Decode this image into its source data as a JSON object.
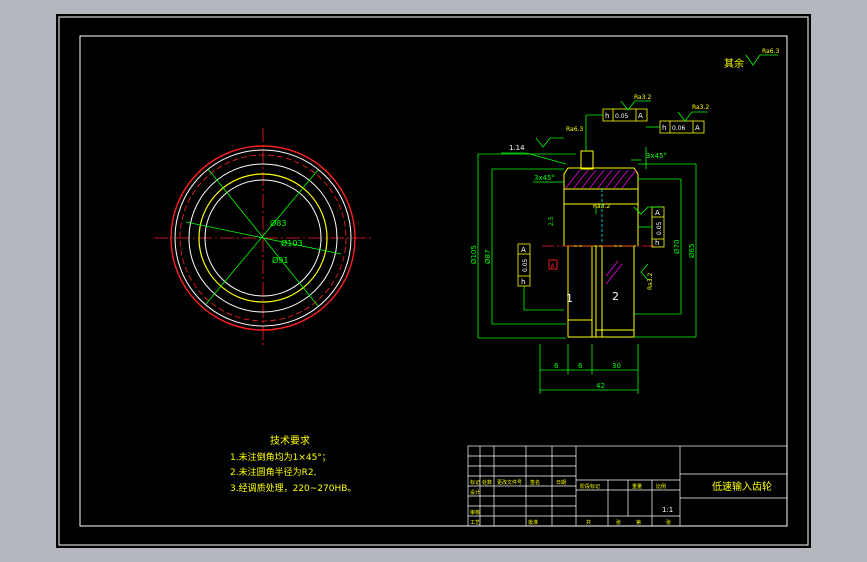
{
  "colors": {
    "background_window": "#b4b7bd",
    "paper": "#000000",
    "frame": "#ffffff",
    "outline": "#ffff00",
    "dimension": "#00ff00",
    "center": "#ff2020",
    "hatch": "#ff00ff",
    "hidden": "#00e5ff"
  },
  "front_view": {
    "dims": [
      "Ø83",
      "Ø103",
      "Ø91"
    ]
  },
  "section_view": {
    "roughness_other": "其余",
    "roughness_other_value": "Ra6.3",
    "roughness_1": "Ra3.2",
    "roughness_2": "Ra3.2",
    "roughness_3": "Ra6.3",
    "roughness_4": "Ra3.2",
    "roughness_5": "Ra3.2",
    "tol_1": [
      "h",
      "0.05",
      "A"
    ],
    "tol_2": [
      "h",
      "0.06",
      "A"
    ],
    "tol_3": [
      "h",
      "0.05",
      "A"
    ],
    "tol_4": [
      "h",
      "0.05",
      "A"
    ],
    "chamfer_top": "3x45°",
    "chamfer_left": "3x45°",
    "dim_114": "1.14",
    "dim_left_outer": "Ø105",
    "dim_left_inner": "Ø87",
    "dim_right_1": "Ø70",
    "dim_right_2": "Ø65",
    "dim_small": "2.5",
    "bottom_dims": [
      "6",
      "6",
      "30"
    ],
    "bottom_total": "42",
    "datum": "A",
    "part_labels": [
      "1",
      "2"
    ]
  },
  "tech_requirements": {
    "title": "技术要求",
    "lines": [
      "1.未注倒角均为1×45°；",
      "2.未注圆角半径为R2,",
      "3.经调质处理，220~270HB。"
    ]
  },
  "title_block": {
    "part_name": "低速输入齿轮",
    "scale": "1:1",
    "labels": [
      "标记",
      "处数",
      "更改文件号",
      "签名",
      "日期",
      "设计",
      "审核",
      "工艺",
      "批准"
    ],
    "bottom_labels": [
      "共",
      "张",
      "第",
      "张"
    ],
    "col_labels": [
      "阶段标记",
      "重量",
      "比例"
    ]
  }
}
